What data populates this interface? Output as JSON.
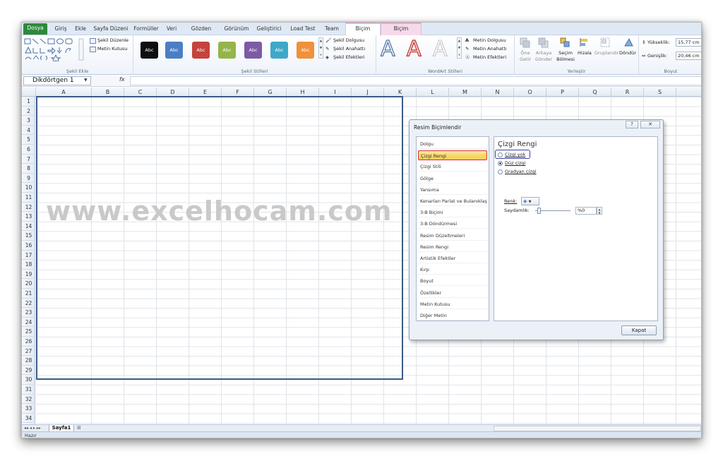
{
  "ribbon_tabs": [
    {
      "label": "Dosya"
    },
    {
      "label": "Giriş"
    },
    {
      "label": "Ekle"
    },
    {
      "label": "Sayfa Düzeni"
    },
    {
      "label": "Formüller"
    },
    {
      "label": "Veri"
    },
    {
      "label": "Gözden Geçir"
    },
    {
      "label": "Görünüm"
    },
    {
      "label": "Geliştirici"
    },
    {
      "label": "Load Test"
    },
    {
      "label": "Team"
    },
    {
      "label": "Biçim"
    },
    {
      "label": "Biçim"
    }
  ],
  "ribbon": {
    "shape_edit_label": "Şekil Düzenle",
    "text_box_label": "Metin Kutusu",
    "insert_shapes_group": "Şekil Ekle",
    "style_button_text": "Abc",
    "style_colors": [
      "#0f0f0f",
      "#4a7ec4",
      "#c5433d",
      "#94b54a",
      "#7d5aa5",
      "#3ea8c8",
      "#f0913b"
    ],
    "shape_fill": "Şekil Dolgusu",
    "shape_outline": "Şekil Anahattı",
    "shape_effects": "Şekil Efektleri",
    "shape_styles_group": "Şekil Stilleri",
    "text_fill": "Metin Dolgusu",
    "text_outline": "Metin Anahattı",
    "text_effects": "Metin Efektleri",
    "wordart_group": "WordArt Stilleri",
    "bring_front": "Öne Getir",
    "send_back": "Arkaya Gönder",
    "selection_pane": "Seçim Bölmesi",
    "align": "Hizala",
    "group": "Gruplandır",
    "rotate": "Döndür",
    "arrange_group": "Yerleştir",
    "height_label": "Yükseklik:",
    "height_value": "15,77 cm",
    "width_label": "Genişlik:",
    "width_value": "20,46 cm",
    "size_group": "Boyut"
  },
  "formula_bar": {
    "name_box": "Dikdörtgen 1",
    "fx": "fx"
  },
  "columns": [
    "A",
    "B",
    "C",
    "D",
    "E",
    "F",
    "G",
    "H",
    "I",
    "J",
    "K",
    "L",
    "M",
    "N",
    "O",
    "P",
    "Q",
    "R",
    "S"
  ],
  "rows": [
    "1",
    "2",
    "3",
    "4",
    "5",
    "6",
    "7",
    "8",
    "9",
    "10",
    "11",
    "12",
    "13",
    "14",
    "15",
    "16",
    "17",
    "18",
    "19",
    "20",
    "21",
    "22",
    "23",
    "24",
    "25",
    "26",
    "27",
    "28",
    "29",
    "30",
    "31",
    "32",
    "33",
    "34"
  ],
  "watermark": "www.excelhocam.com",
  "sheet_tab": "Sayfa1",
  "status": "Hazır",
  "dialog": {
    "title": "Resim Biçimlendir",
    "help": "?",
    "close_x": "✕",
    "categories": [
      "Dolgu",
      "Çizgi Rengi",
      "Çizgi Stili",
      "Gölge",
      "Yansıma",
      "Kenarları Parlat ve Bulanıklaştır",
      "3-B Biçimi",
      "3-B Döndürmesi",
      "Resim Düzeltmeleri",
      "Resim Rengi",
      "Artistik Efektler",
      "Kırp",
      "Boyut",
      "Özellikler",
      "Metin Kutusu",
      "Diğer Metin"
    ],
    "selected_category": "Çizgi Rengi",
    "panel_title": "Çizgi Rengi",
    "option_none": "Çizgi yok",
    "option_solid": "Düz çizgi",
    "option_gradient": "Gradyan çizgi",
    "color_label": "Renk:",
    "transparency_label": "Saydamlık:",
    "transparency_value": "%0",
    "close_button": "Kapat"
  }
}
